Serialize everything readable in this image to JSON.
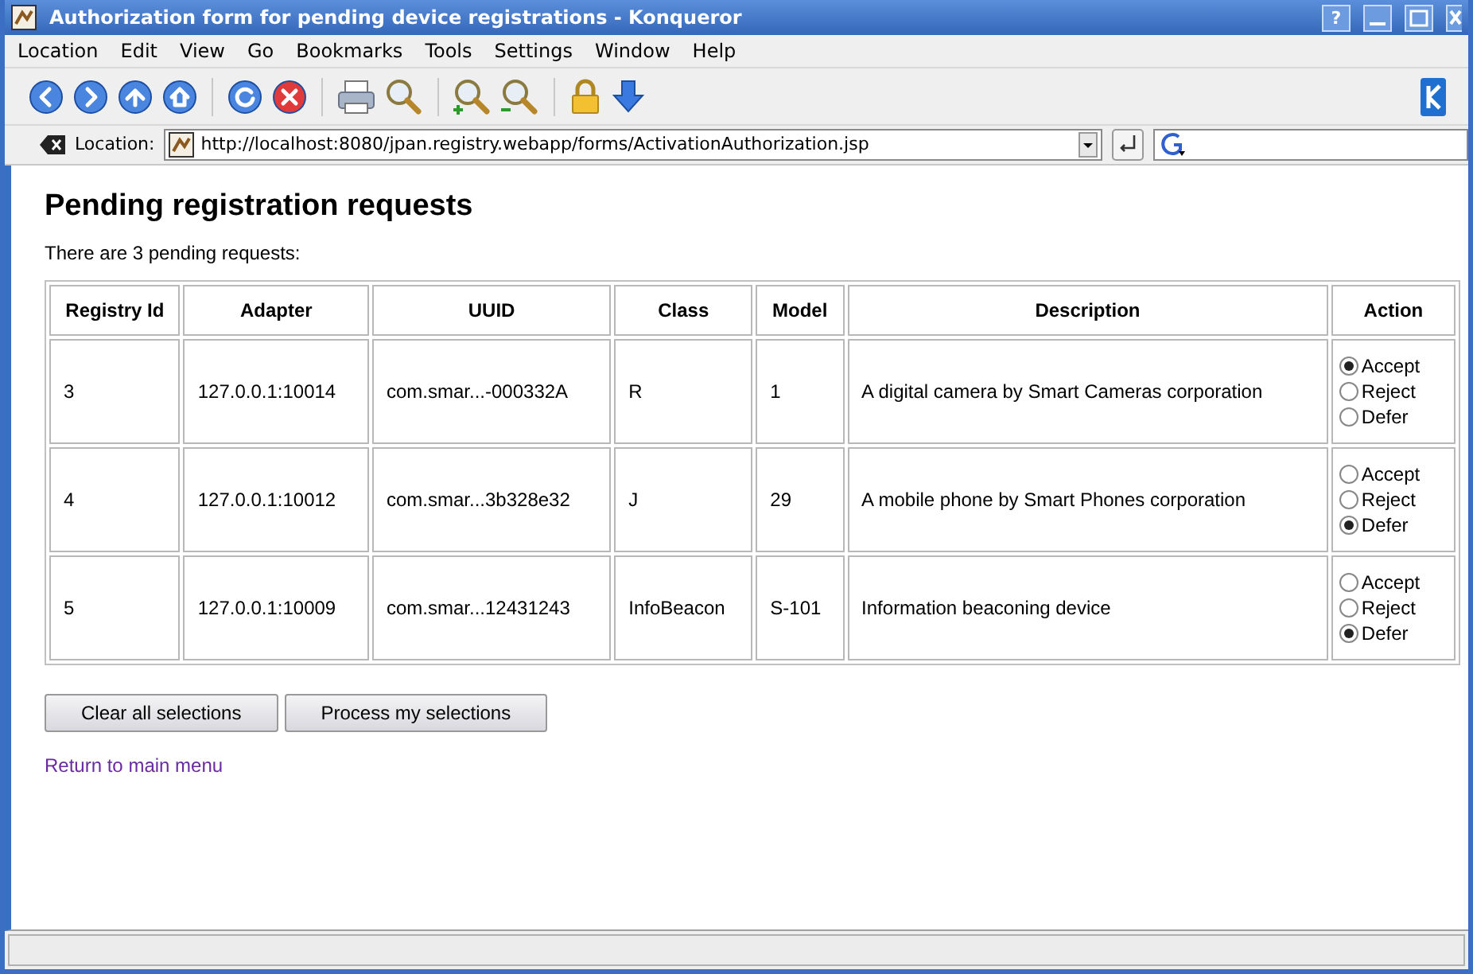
{
  "window": {
    "title": "Authorization form for pending device registrations - Konqueror",
    "buttons": [
      "?"
    ]
  },
  "menu": [
    "Location",
    "Edit",
    "View",
    "Go",
    "Bookmarks",
    "Tools",
    "Settings",
    "Window",
    "Help"
  ],
  "location_bar": {
    "label": "Location:",
    "url": "http://localhost:8080/jpan.registry.webapp/forms/ActivationAuthorization.jsp"
  },
  "page": {
    "heading": "Pending registration requests",
    "summary": "There are 3 pending requests:",
    "table": {
      "columns": [
        "Registry Id",
        "Adapter",
        "UUID",
        "Class",
        "Model",
        "Description",
        "Action"
      ],
      "rows": [
        {
          "cells": [
            "3",
            "127.0.0.1:10014",
            "com.smar...-000332A",
            "R",
            "1",
            "A digital camera by Smart Cameras corporation"
          ],
          "options": [
            {
              "label": "Accept",
              "selected": true
            },
            {
              "label": "Reject",
              "selected": false
            },
            {
              "label": "Defer",
              "selected": false
            }
          ]
        },
        {
          "cells": [
            "4",
            "127.0.0.1:10012",
            "com.smar...3b328e32",
            "J",
            "29",
            "A mobile phone by Smart Phones corporation"
          ],
          "options": [
            {
              "label": "Accept",
              "selected": false
            },
            {
              "label": "Reject",
              "selected": false
            },
            {
              "label": "Defer",
              "selected": true
            }
          ]
        },
        {
          "cells": [
            "5",
            "127.0.0.1:10009",
            "com.smar...12431243",
            "InfoBeacon",
            "S-101",
            "Information beaconing device"
          ],
          "options": [
            {
              "label": "Accept",
              "selected": false
            },
            {
              "label": "Reject",
              "selected": false
            },
            {
              "label": "Defer",
              "selected": true
            }
          ]
        }
      ]
    },
    "buttons": [
      "Clear all selections",
      "Process my selections"
    ],
    "link": "Return to main menu"
  }
}
